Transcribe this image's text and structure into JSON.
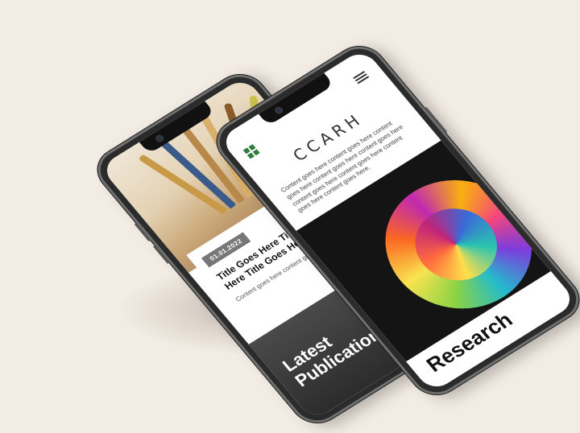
{
  "left_screen": {
    "post": {
      "date": "01.01.2022",
      "title": "Title Goes Here Title Goes Here Title Goes Here",
      "body": "Content goes here content goes here"
    },
    "section_heading": "Latest Publications"
  },
  "right_screen": {
    "site_name": "CCARH",
    "intro": "Content goes here content goes here content goes here content goes here content goes here content goes here content goes here content goes here content goes here.",
    "section_heading": "Research"
  },
  "colors": {
    "background": "#f3ece4",
    "date_badge": "#777777",
    "logo_green": "#2e7d3a",
    "dark_section": "#2c2c2c"
  }
}
